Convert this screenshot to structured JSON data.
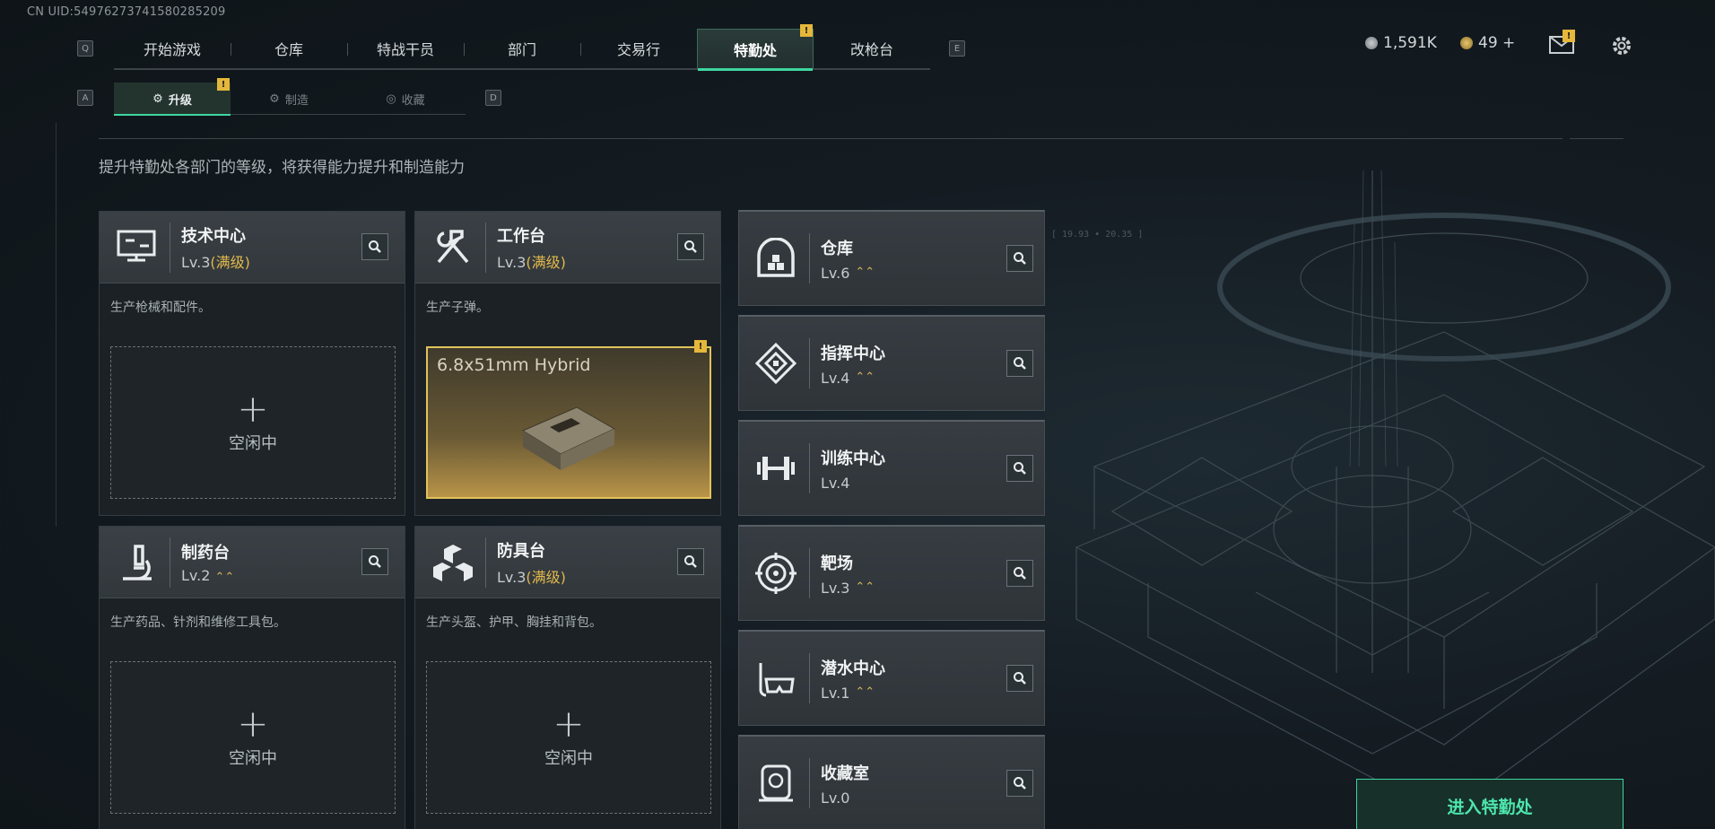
{
  "uid": "CN UID:549762737415802852​09",
  "keys": {
    "prev_tab": "Q",
    "next_tab": "E",
    "prev_sub": "A",
    "next_sub": "D"
  },
  "nav": {
    "tabs": [
      "开始游戏",
      "仓库",
      "特战干员",
      "部门",
      "交易行",
      "特勤处",
      "改枪台"
    ],
    "active": "特勤处",
    "notif": "!"
  },
  "status": {
    "currency1": "1,591K",
    "currency2": "49 +",
    "mail_notif": "!"
  },
  "subnav": {
    "tabs": [
      "升级",
      "制造",
      "收藏"
    ],
    "active": "升级",
    "notif": "!"
  },
  "description": "提升特勤处各部门的等级，将获得能力提升和制造能力",
  "cards": [
    {
      "name": "技术中心",
      "level": "Lv.3",
      "max": "(满级)",
      "desc": "生产枪械和配件。",
      "idle_label": "空闲中",
      "plus": "+"
    },
    {
      "name": "工作台",
      "level": "Lv.3",
      "max": "(满级)",
      "desc": "生产子弹。",
      "item": "6.8x51mm Hybrid",
      "notif": "!"
    },
    {
      "name": "制药台",
      "level": "Lv.2",
      "desc": "生产药品、针剂和维修工具包。",
      "idle_label": "空闲中",
      "plus": "+",
      "upgradable": true
    },
    {
      "name": "防具台",
      "level": "Lv.3",
      "max": "(满级)",
      "desc": "生产头盔、护甲、胸挂和背包。",
      "idle_label": "空闲中",
      "plus": "+"
    }
  ],
  "departments": [
    {
      "name": "仓库",
      "level": "Lv.6",
      "upgradable": true,
      "icon": "vault-icon"
    },
    {
      "name": "指挥中心",
      "level": "Lv.4",
      "upgradable": true,
      "icon": "command-icon"
    },
    {
      "name": "训练中心",
      "level": "Lv.4",
      "upgradable": false,
      "icon": "dumbbell-icon"
    },
    {
      "name": "靶场",
      "level": "Lv.3",
      "upgradable": true,
      "icon": "target-icon"
    },
    {
      "name": "潜水中心",
      "level": "Lv.1",
      "upgradable": true,
      "icon": "diving-mask-icon"
    },
    {
      "name": "收藏室",
      "level": "Lv.0",
      "upgradable": false,
      "icon": "collection-icon"
    }
  ],
  "enter_button": "进入特勤处",
  "coords": "[ 19.93 • 20.35 ]",
  "colors": {
    "accent": "#3fd6a0",
    "gold": "#e2b94c",
    "notif": "#e5b73a"
  }
}
